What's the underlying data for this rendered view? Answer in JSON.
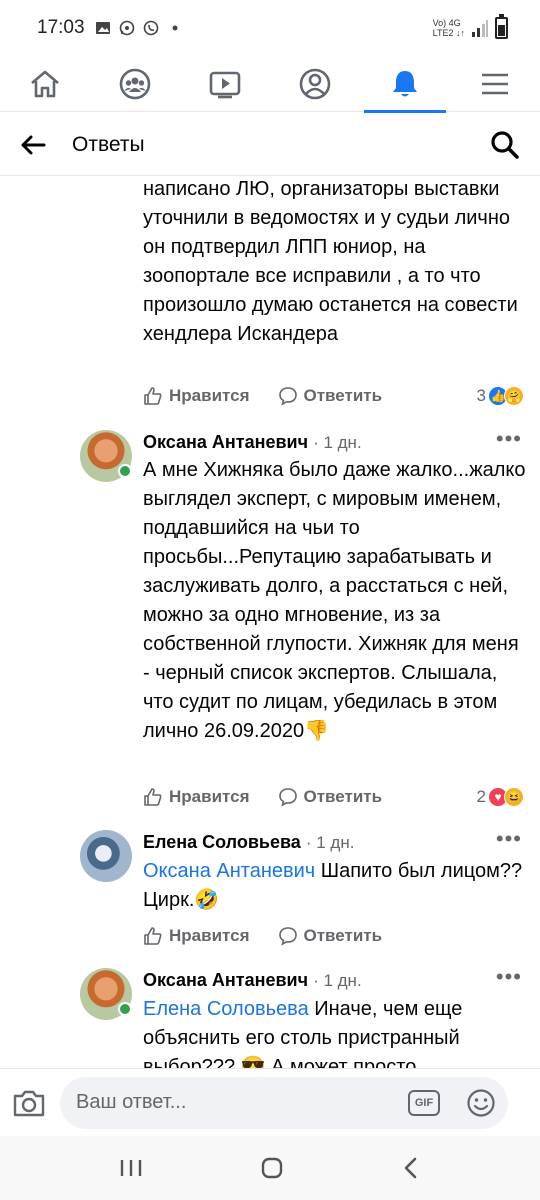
{
  "status_bar": {
    "time": "17:03",
    "network_top": "Vo) 4G",
    "network_bottom": "LTE2 ↓↑"
  },
  "nav": {
    "items": [
      "home-icon",
      "groups-icon",
      "watch-icon",
      "profile-icon",
      "notifications-icon",
      "menu-icon"
    ],
    "active": "notifications-icon",
    "accent": "#1877f2"
  },
  "header": {
    "title": "Ответы"
  },
  "comments": {
    "c0": {
      "text": "написано ЛЮ, организаторы выставки уточнили в ведомостях и у судьи лично он подтвердил ЛПП юниор, на зоопортале все исправили , а то что произошло думаю останется на совести хендлера Искандера",
      "like_label": "Нравится",
      "reply_label": "Ответить",
      "reaction_count": "3"
    },
    "c1": {
      "author": "Оксана Антаневич",
      "time": "· 1 дн.",
      "text": "А мне Хижняка было даже жалко...жалко выглядел эксперт, с мировым именем, поддавшийся на чьи то просьбы...Репутацию зарабатывать и заслуживать долго, а расстаться с ней, можно за одно мгновение, из за собственной глупости. Хижняк для меня  - черный список экспертов.  Слышала, что судит по лицам, убедилась в этом лично 26.09.2020👎",
      "like_label": "Нравится",
      "reply_label": "Ответить",
      "reaction_count": "2"
    },
    "c2": {
      "author": "Елена Соловьева",
      "time": "· 1 дн.",
      "mention": "Оксана Антаневич",
      "text": " Шапито был лицом?? Цирк.🤣",
      "like_label": "Нравится",
      "reply_label": "Ответить"
    },
    "c3": {
      "author": "Оксана Антаневич",
      "time": "· 1 дн.",
      "mention": "Елена Соловьева",
      "text": " Иначе, чем еще объяснить его столь пристранный выбор??? 😎 А может просто"
    }
  },
  "composer": {
    "placeholder": "Ваш ответ...",
    "gif_label": "GIF"
  }
}
